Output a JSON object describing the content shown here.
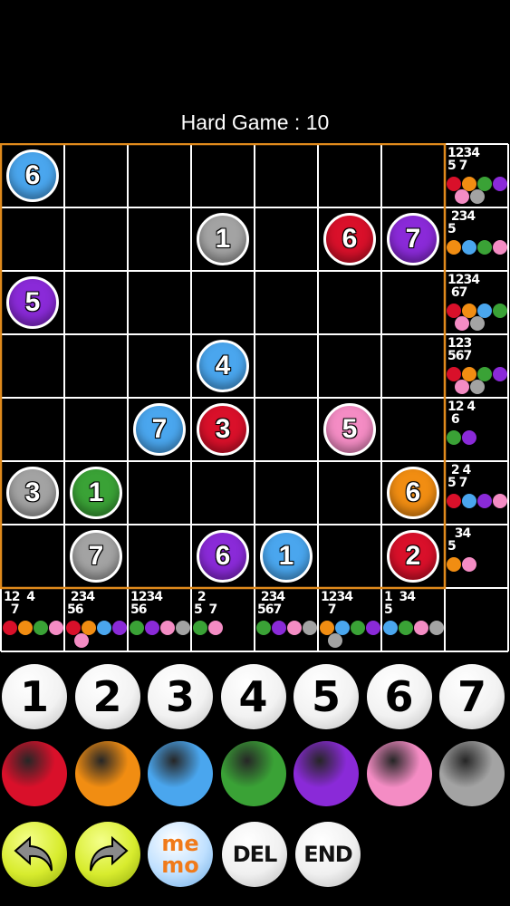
{
  "title": "Hard Game : 10",
  "colors": {
    "red": "#d9102a",
    "orange": "#f18d12",
    "blue": "#4aa6ee",
    "green": "#3aa236",
    "purple": "#8a2ad8",
    "pink": "#f48cc4",
    "gray": "#a3a3a3"
  },
  "grid": {
    "size": 7,
    "givens": [
      {
        "row": 0,
        "col": 0,
        "num": "6",
        "color": "blue"
      },
      {
        "row": 1,
        "col": 3,
        "num": "1",
        "color": "gray"
      },
      {
        "row": 1,
        "col": 5,
        "num": "6",
        "color": "red"
      },
      {
        "row": 1,
        "col": 6,
        "num": "7",
        "color": "purple"
      },
      {
        "row": 2,
        "col": 0,
        "num": "5",
        "color": "purple"
      },
      {
        "row": 3,
        "col": 3,
        "num": "4",
        "color": "blue"
      },
      {
        "row": 4,
        "col": 2,
        "num": "7",
        "color": "blue"
      },
      {
        "row": 4,
        "col": 3,
        "num": "3",
        "color": "red"
      },
      {
        "row": 4,
        "col": 5,
        "num": "5",
        "color": "pink"
      },
      {
        "row": 5,
        "col": 0,
        "num": "3",
        "color": "gray"
      },
      {
        "row": 5,
        "col": 1,
        "num": "1",
        "color": "green"
      },
      {
        "row": 5,
        "col": 6,
        "num": "6",
        "color": "orange"
      },
      {
        "row": 6,
        "col": 1,
        "num": "7",
        "color": "gray"
      },
      {
        "row": 6,
        "col": 3,
        "num": "6",
        "color": "purple"
      },
      {
        "row": 6,
        "col": 4,
        "num": "1",
        "color": "blue"
      },
      {
        "row": 6,
        "col": 6,
        "num": "2",
        "color": "red"
      }
    ],
    "row_hints": [
      {
        "nums": "1234\n5 7",
        "colors": [
          "red",
          "orange",
          "green",
          "purple",
          "pink",
          "gray"
        ]
      },
      {
        "nums": " 234\n5",
        "colors": [
          "orange",
          "blue",
          "green",
          "pink"
        ]
      },
      {
        "nums": "1234\n 67",
        "colors": [
          "red",
          "orange",
          "blue",
          "green",
          "pink",
          "gray"
        ]
      },
      {
        "nums": "123\n567",
        "colors": [
          "red",
          "orange",
          "green",
          "purple",
          "pink",
          "gray"
        ]
      },
      {
        "nums": "12 4\n 6",
        "colors": [
          "green",
          "purple"
        ]
      },
      {
        "nums": " 2 4\n5 7",
        "colors": [
          "red",
          "blue",
          "purple",
          "pink"
        ]
      },
      {
        "nums": "  34\n5",
        "colors": [
          "orange",
          "pink"
        ]
      }
    ],
    "col_hints": [
      {
        "nums": "12  4\n  7",
        "colors": [
          "red",
          "orange",
          "green",
          "pink"
        ]
      },
      {
        "nums": " 234\n56",
        "colors": [
          "red",
          "orange",
          "blue",
          "purple",
          "pink"
        ]
      },
      {
        "nums": "1234\n56",
        "colors": [
          "green",
          "purple",
          "pink",
          "gray"
        ]
      },
      {
        "nums": " 2\n5  7",
        "colors": [
          "green",
          "pink"
        ]
      },
      {
        "nums": " 234\n567",
        "colors": [
          "green",
          "purple",
          "pink",
          "gray"
        ]
      },
      {
        "nums": "1234\n  7",
        "colors": [
          "orange",
          "blue",
          "green",
          "purple",
          "gray"
        ]
      },
      {
        "nums": "1  34\n5",
        "colors": [
          "blue",
          "green",
          "pink",
          "gray"
        ]
      }
    ]
  },
  "numpad": [
    "1",
    "2",
    "3",
    "4",
    "5",
    "6",
    "7"
  ],
  "color_buttons": [
    "red",
    "orange",
    "blue",
    "green",
    "purple",
    "pink",
    "gray"
  ],
  "tools": {
    "undo_icon": "undo-arrow-icon",
    "redo_icon": "redo-arrow-icon",
    "memo_top": "me",
    "memo_bottom": "mo",
    "del": "DEL",
    "end": "END"
  }
}
